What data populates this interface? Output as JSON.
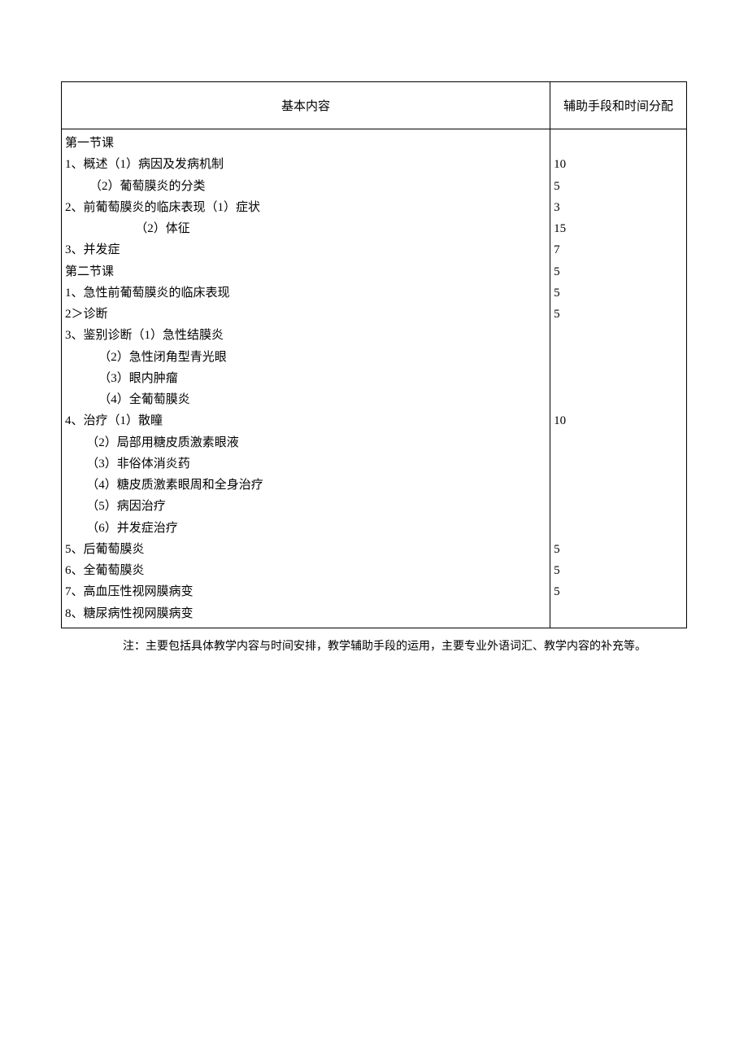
{
  "header": {
    "col1": "基本内容",
    "col2": "辅助手段和时间分配"
  },
  "content_lines": [
    "第一节课",
    "1、概述（1）病因及发病机制",
    "        （2）葡萄膜炎的分类",
    "2、前葡萄膜炎的临床表现（1）症状",
    "                       （2）体征",
    "3、并发症",
    "第二节课",
    "1、急性前葡萄膜炎的临床表现",
    "2＞诊断",
    "3、鉴别诊断（1）急性结膜炎",
    "           （2）急性闭角型青光眼",
    "           （3）眼内肿瘤",
    "           （4）全葡萄膜炎",
    "4、治疗（1）散瞳",
    "       （2）局部用糖皮质激素眼液",
    "       （3）非俗体消炎药",
    "       （4）糖皮质激素眼周和全身治疗",
    "       （5）病因治疗",
    "       （6）并发症治疗",
    "5、后葡萄膜炎",
    "6、全葡萄膜炎",
    "7、高血压性视网膜病变",
    "8、糖尿病性视网膜病变"
  ],
  "time_lines": [
    "",
    "10",
    "5",
    "3",
    "15",
    "7",
    "5",
    "5",
    "5",
    "",
    "",
    "",
    "",
    "10",
    "",
    "",
    "",
    "",
    "",
    "5",
    "5",
    "5",
    ""
  ],
  "footnote": "注：主要包括具体教学内容与时间安排，教学辅助手段的运用，主要专业外语词汇、教学内容的补充等。"
}
